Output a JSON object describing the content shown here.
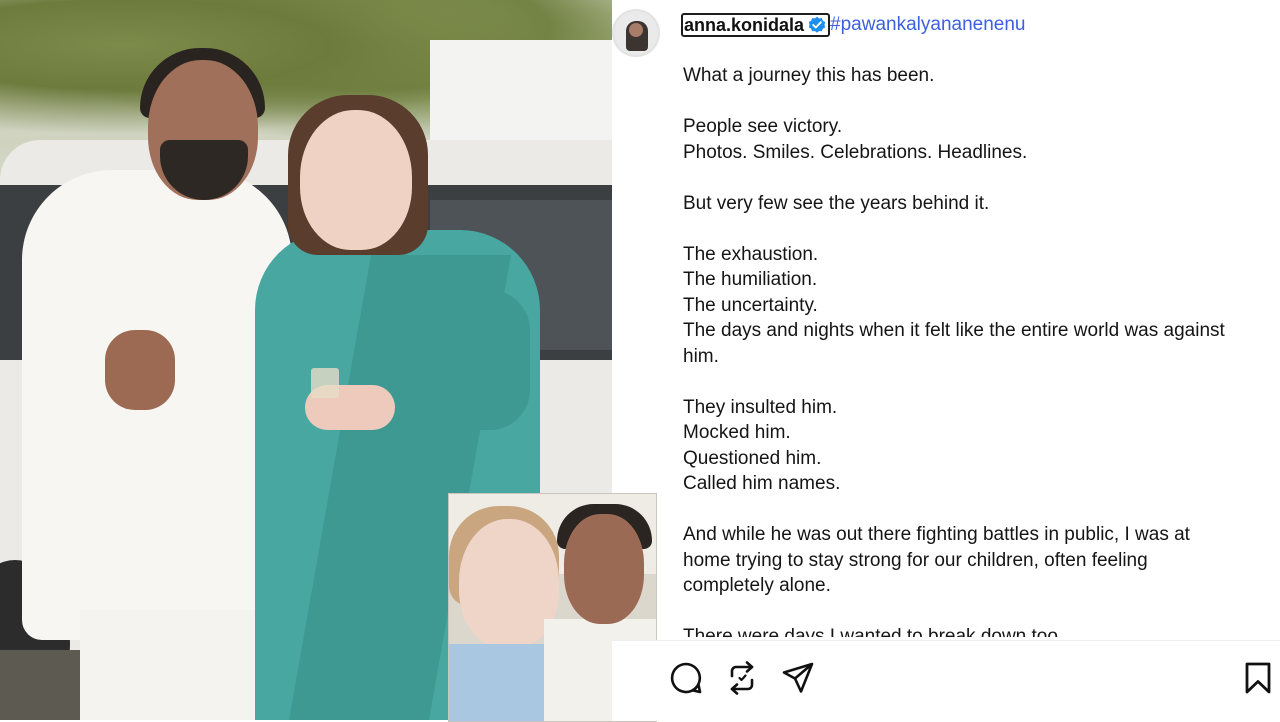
{
  "post": {
    "username": "anna.konidala",
    "hashtag": "#pawankalyananenenu",
    "caption_lines": [
      "What a journey this has been.",
      "",
      "People see victory.",
      "Photos. Smiles. Celebrations. Headlines.",
      "",
      "But very few see the years behind it.",
      "",
      "The exhaustion.",
      "The humiliation.",
      "The uncertainty.",
      "The days and nights when it felt like the entire world was against",
      "him.",
      "",
      "They insulted him.",
      "Mocked him.",
      "Questioned him.",
      "Called him names.",
      "",
      "And while he was out there fighting battles in public, I was at",
      "home trying to stay strong for our children, often feeling",
      "completely alone.",
      "",
      "There were days I wanted to break down too."
    ]
  },
  "icons": {
    "verified": "verified-badge-icon",
    "comment": "comment-icon",
    "repost": "repost-icon",
    "share": "share-icon",
    "save": "bookmark-icon"
  },
  "colors": {
    "hashtag": "#3d5fe0",
    "verified": "#1f8ef1",
    "text": "#151515"
  }
}
